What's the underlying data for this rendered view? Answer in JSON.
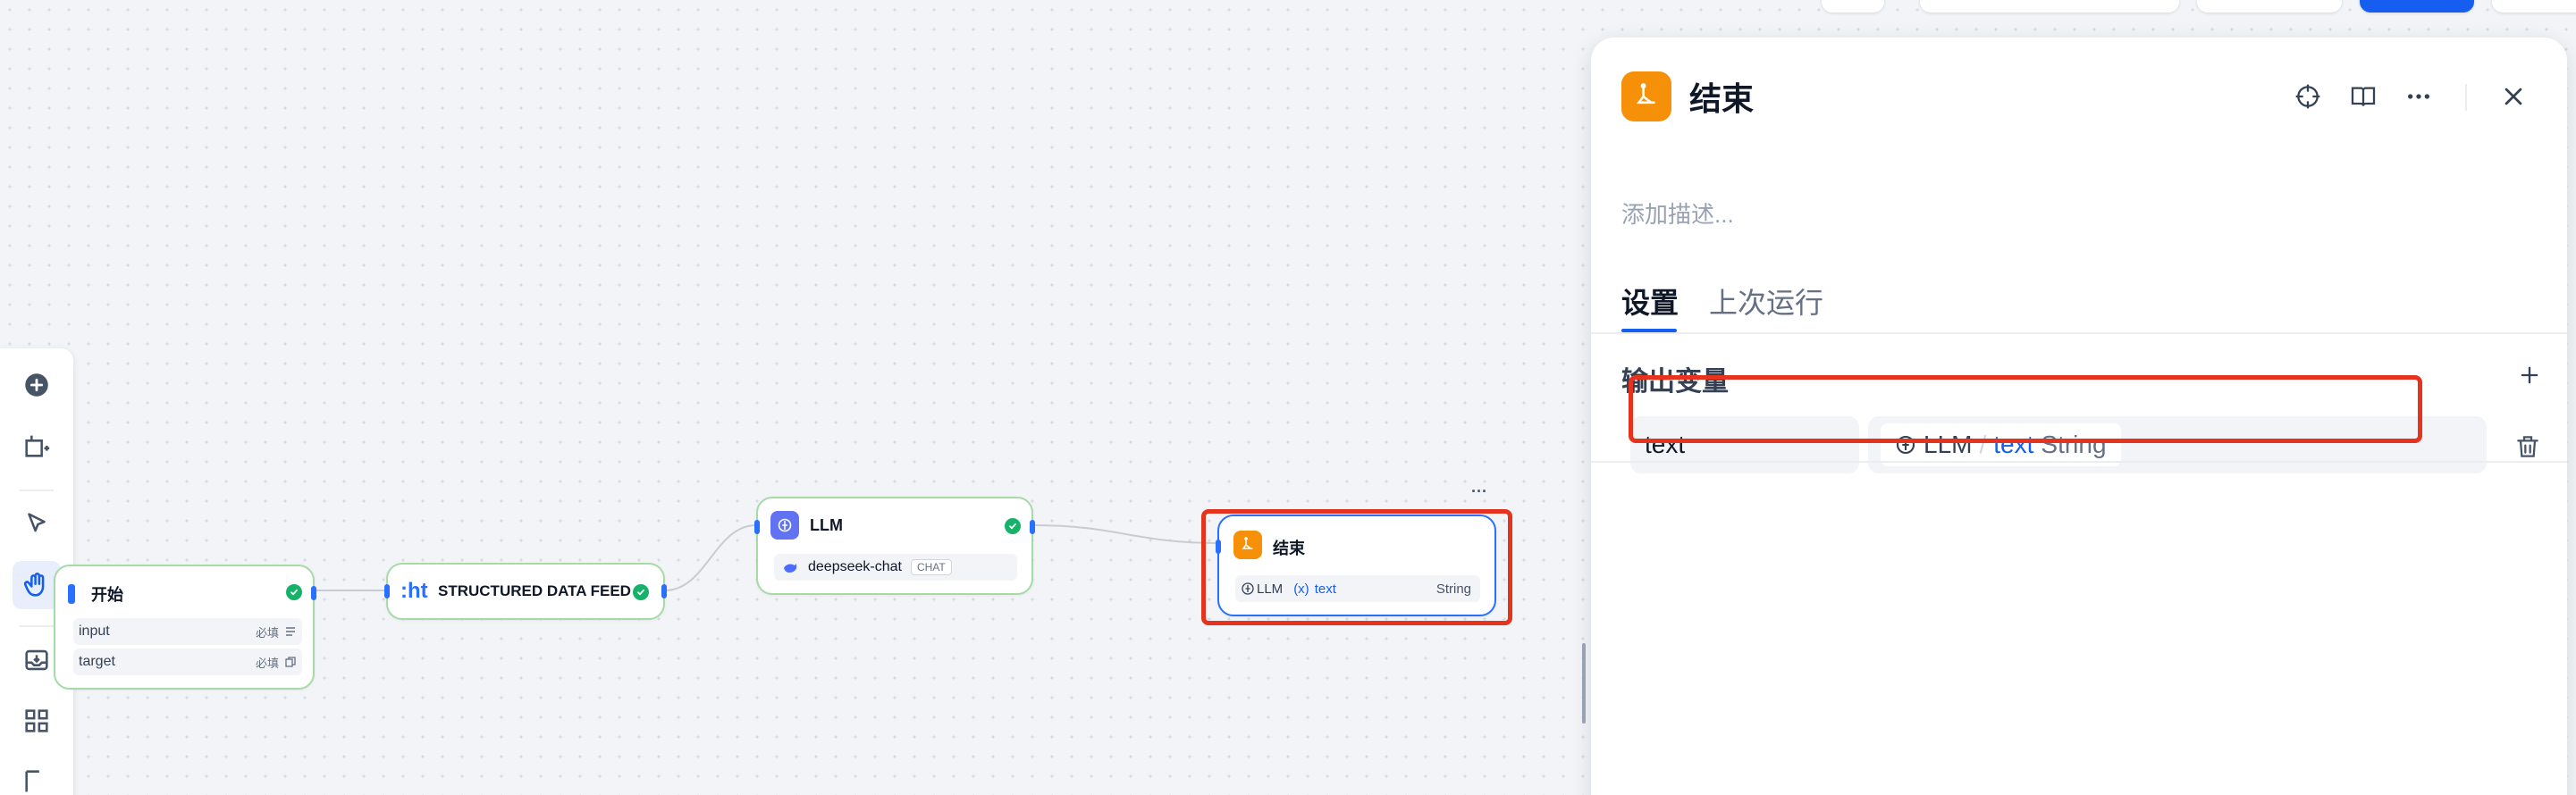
{
  "colors": {
    "accent": "#155eef",
    "success": "#17b26a",
    "end_icon": "#f79009",
    "llm_icon": "#6172f3",
    "highlight": "#e5331e"
  },
  "canvas": {
    "nodes": {
      "start": {
        "title": "开始",
        "icon": "start-icon",
        "variables": [
          {
            "name": "input",
            "required": "必填",
            "type_icon": "text-lines-icon"
          },
          {
            "name": "target",
            "required": "必填",
            "type_icon": "copy-icon"
          }
        ]
      },
      "feed": {
        "title": "STRUCTURED DATA FEED:",
        "icon_text": ":ht"
      },
      "llm": {
        "title": "LLM",
        "model": "deepseek-chat",
        "model_mode": "CHAT"
      },
      "end": {
        "title": "结束",
        "more_label": "···",
        "output": {
          "source": "LLM",
          "var_prefix": "(x)",
          "var_name": "text",
          "type": "String"
        }
      }
    }
  },
  "panel": {
    "title": "结束",
    "description_placeholder": "添加描述...",
    "tabs": [
      {
        "label": "设置",
        "active": true
      },
      {
        "label": "上次运行",
        "active": false
      }
    ],
    "section_title": "输出变量",
    "variable": {
      "name": "text",
      "ref_node": "LLM",
      "ref_separator": "/",
      "ref_var": "text",
      "ref_type": "String"
    }
  }
}
